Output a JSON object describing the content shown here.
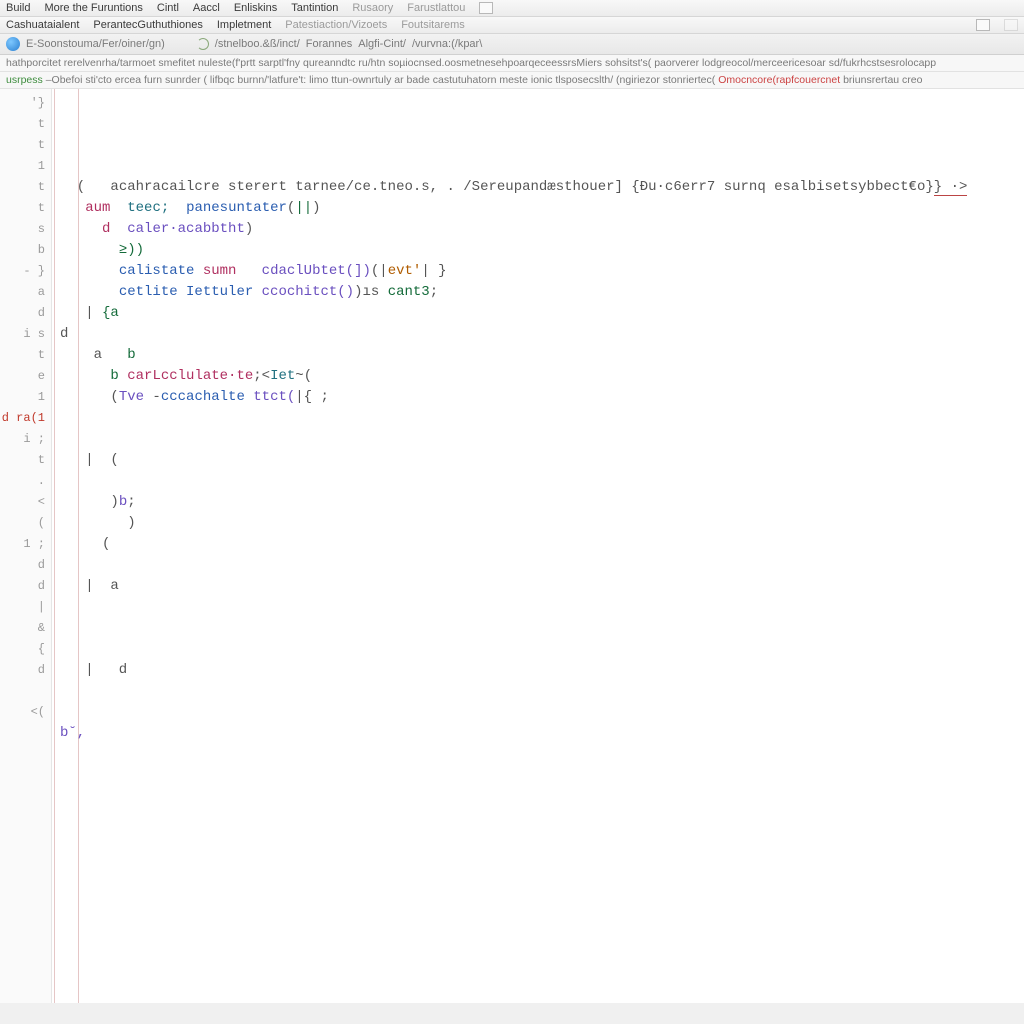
{
  "menu1": {
    "items": [
      {
        "label": "Build",
        "dim": false
      },
      {
        "label": "More the Furuntions",
        "dim": false
      },
      {
        "label": "Cintl",
        "dim": false
      },
      {
        "label": "Aaccl",
        "dim": false
      },
      {
        "label": "Enliskins",
        "dim": false
      },
      {
        "label": "Tantintion",
        "dim": false
      },
      {
        "label": "Rusaory",
        "dim": true
      },
      {
        "label": "Farustlattou",
        "dim": true
      }
    ]
  },
  "menu2": {
    "items": [
      {
        "label": "Cashuataialent",
        "dim": false
      },
      {
        "label": "PerantecGuthuthiones",
        "dim": false
      },
      {
        "label": "Impletment",
        "dim": false
      },
      {
        "label": "Patestiaction/Vizoets",
        "dim": true
      },
      {
        "label": "Foutsitarems",
        "dim": true
      }
    ]
  },
  "addr": {
    "url": "E-Soonstouma/Fer/oiner/gn)",
    "crumbs": [
      "/stnelboo.&ß/inct/",
      "Forannes",
      "Algfi-Cint/",
      "/vurvna:(/kpar\\"
    ]
  },
  "strip1": {
    "text": "hathporcitet  rerelvenrha/tarmoet smefitet nuleste(f'prtt sarptl'fny qureanndtc ru/htn soµiocnsed.oosmetnesehpoarqeceessrsMiers sohsitst's(  paorverer lodgreocol/merceericesoar sd/fukrhcstsesrolocapp"
  },
  "strip2": {
    "lead": "usrpess",
    "mid": "–Obefoi sti'cto ercea furn sunrder ( lifbqc burnn/'latfure't: limo ttun-ownrtuly ar bade castutuhatorn meste ionic tlsposecslth/ (ngiriezor stonriertec(",
    "warn": "Omocncore(rapfcouercnet",
    "tail": "briunsrertau creo"
  },
  "code": {
    "lines": [
      {
        "g": "'}",
        "frags": [
          {
            "t": "  (   ",
            "c": "pun"
          },
          {
            "t": "acahracailcre sterert tarnee/ce.tneo.s, . /Sereupandæsthouer] {Ðu·c6err7 surnq esalbisetsybbect€o}",
            "c": "pun"
          },
          {
            "t": "} ·>",
            "c": "pun"
          }
        ]
      },
      {
        "g": "t",
        "frags": [
          {
            "t": "   ",
            "c": ""
          },
          {
            "t": "aum",
            "c": "kw"
          },
          {
            "t": "  ",
            "c": ""
          },
          {
            "t": "teec;",
            "c": "lit"
          },
          {
            "t": "  ",
            "c": ""
          },
          {
            "t": "panesuntater",
            "c": "fn"
          },
          {
            "t": "(",
            "c": "pun"
          },
          {
            "t": "||",
            "c": "id"
          },
          {
            "t": ")",
            "c": "pun"
          }
        ]
      },
      {
        "g": "t",
        "frags": [
          {
            "t": "     ",
            "c": ""
          },
          {
            "t": "d",
            "c": "kw"
          },
          {
            "t": "  ",
            "c": ""
          },
          {
            "t": "caler·acabbtht",
            "c": "fn2"
          },
          {
            "t": ")",
            "c": "pun"
          }
        ]
      },
      {
        "g": "1",
        "frags": [
          {
            "t": "       ",
            "c": ""
          },
          {
            "t": "≥)) ",
            "c": "id"
          }
        ]
      },
      {
        "g": "t",
        "frags": [
          {
            "t": "       ",
            "c": ""
          },
          {
            "t": "calistate",
            "c": "fn"
          },
          {
            "t": " ",
            "c": ""
          },
          {
            "t": "sumn",
            "c": "kw"
          },
          {
            "t": "   ",
            "c": ""
          },
          {
            "t": "cdaclUbtet(])",
            "c": "fn2"
          },
          {
            "t": "(|",
            "c": "pun"
          },
          {
            "t": "evt'",
            "c": "str"
          },
          {
            "t": "| }",
            "c": "pun"
          }
        ]
      },
      {
        "g": "t",
        "frags": [
          {
            "t": "       ",
            "c": ""
          },
          {
            "t": "cetlite",
            "c": "fn"
          },
          {
            "t": " ",
            "c": ""
          },
          {
            "t": "Iettuler",
            "c": "fn"
          },
          {
            "t": " ",
            "c": ""
          },
          {
            "t": "ccochitct()",
            "c": "fn2"
          },
          {
            "t": ")ıs ",
            "c": "pun"
          },
          {
            "t": "cant3",
            "c": "id"
          },
          {
            "t": ";",
            "c": "pun"
          }
        ]
      },
      {
        "g": "s",
        "frags": [
          {
            "t": "   |",
            "c": "pun"
          },
          {
            "t": " {a",
            "c": "id"
          }
        ]
      },
      {
        "g": "b",
        "frags": [
          {
            "t": "d",
            "c": "pun"
          }
        ]
      },
      {
        "g": "-  }",
        "frags": [
          {
            "t": "    a   ",
            "c": "pun"
          },
          {
            "t": "b",
            "c": "id"
          }
        ]
      },
      {
        "g": "a",
        "frags": [
          {
            "t": "      ",
            "c": ""
          },
          {
            "t": "b",
            "c": "id"
          },
          {
            "t": " ",
            "c": ""
          },
          {
            "t": "carLcclulate·te",
            "c": "kw"
          },
          {
            "t": ";<",
            "c": "pun"
          },
          {
            "t": "Iet",
            "c": "lit"
          },
          {
            "t": "~(",
            "c": "pun"
          }
        ]
      },
      {
        "g": "d",
        "frags": [
          {
            "t": "      (",
            "c": "pun"
          },
          {
            "t": "Tve",
            "c": "fn2"
          },
          {
            "t": " -",
            "c": "pun"
          },
          {
            "t": "cccachalte",
            "c": "fn"
          },
          {
            "t": " ",
            "c": ""
          },
          {
            "t": "ttct(",
            "c": "fn2"
          },
          {
            "t": "|{ ;",
            "c": "pun"
          }
        ]
      },
      {
        "g": "i s",
        "frags": []
      },
      {
        "g": "t",
        "frags": []
      },
      {
        "g": "e",
        "frags": [
          {
            "t": "   |  (",
            "c": "pun"
          }
        ]
      },
      {
        "g": "1",
        "frags": []
      },
      {
        "g": "d ra(1",
        "err": true,
        "frags": [
          {
            "t": "      )",
            "c": "pun"
          },
          {
            "t": "b",
            "c": "fn2"
          },
          {
            "t": ";",
            "c": "pun"
          }
        ]
      },
      {
        "g": "i ;",
        "frags": [
          {
            "t": "        )",
            "c": "pun"
          }
        ]
      },
      {
        "g": "t",
        "frags": [
          {
            "t": "     (",
            "c": "pun"
          }
        ]
      },
      {
        "g": ".",
        "frags": []
      },
      {
        "g": "<",
        "frags": [
          {
            "t": "   |  a",
            "c": "pun"
          }
        ]
      },
      {
        "g": "(",
        "frags": []
      },
      {
        "g": "1 ;",
        "frags": []
      },
      {
        "g": "d",
        "frags": []
      },
      {
        "g": "d",
        "frags": [
          {
            "t": "   |   d",
            "c": "pun"
          }
        ]
      },
      {
        "g": "|",
        "frags": []
      },
      {
        "g": "&",
        "frags": []
      },
      {
        "g": "{",
        "frags": [
          {
            "t": "b˘,",
            "c": "fn2"
          }
        ]
      },
      {
        "g": "d",
        "frags": []
      },
      {
        "g": "",
        "frags": []
      },
      {
        "g": "<(",
        "frags": []
      }
    ]
  }
}
